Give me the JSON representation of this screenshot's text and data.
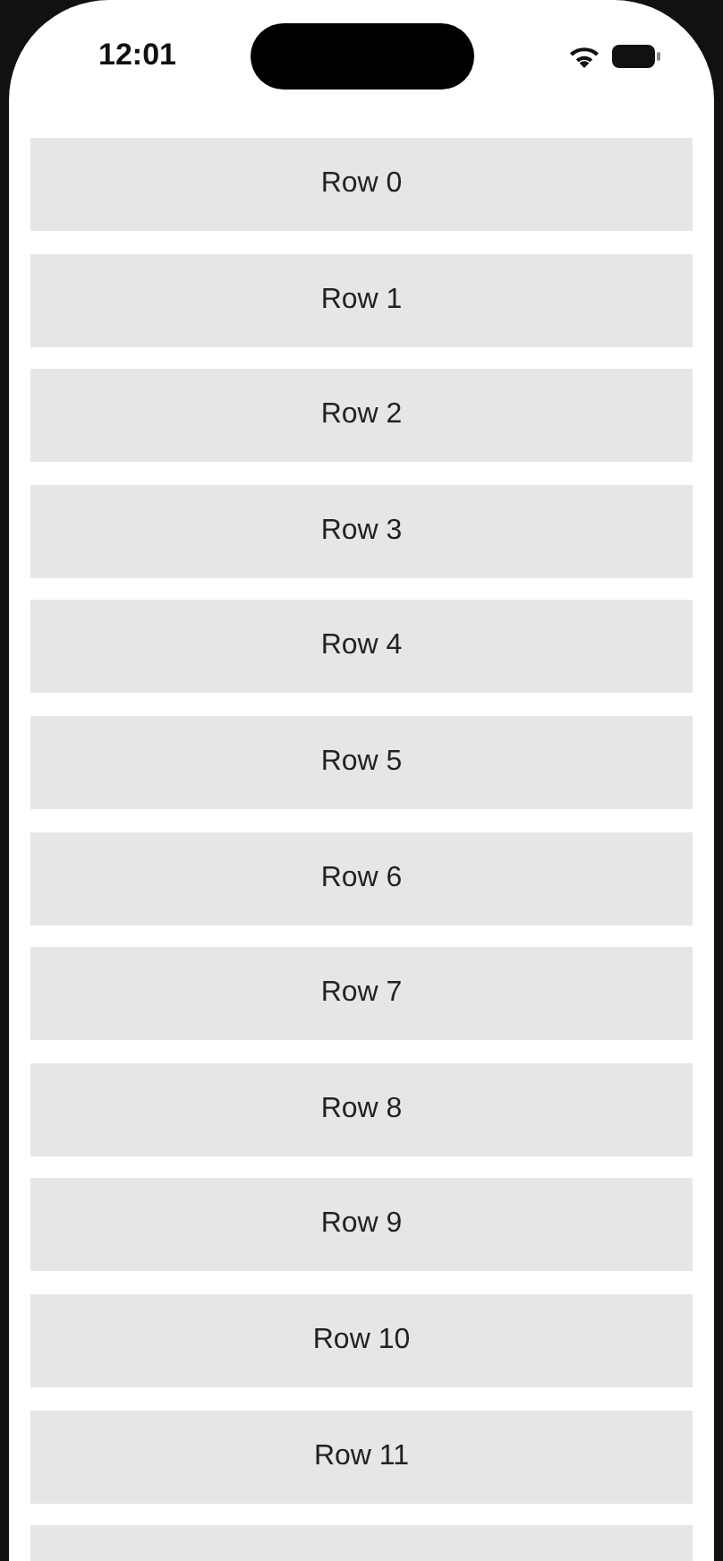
{
  "status_bar": {
    "time": "12:01"
  },
  "rows": [
    "Row 0",
    "Row 1",
    "Row 2",
    "Row 3",
    "Row 4",
    "Row 5",
    "Row 6",
    "Row 7",
    "Row 8",
    "Row 9",
    "Row 10",
    "Row 11"
  ]
}
